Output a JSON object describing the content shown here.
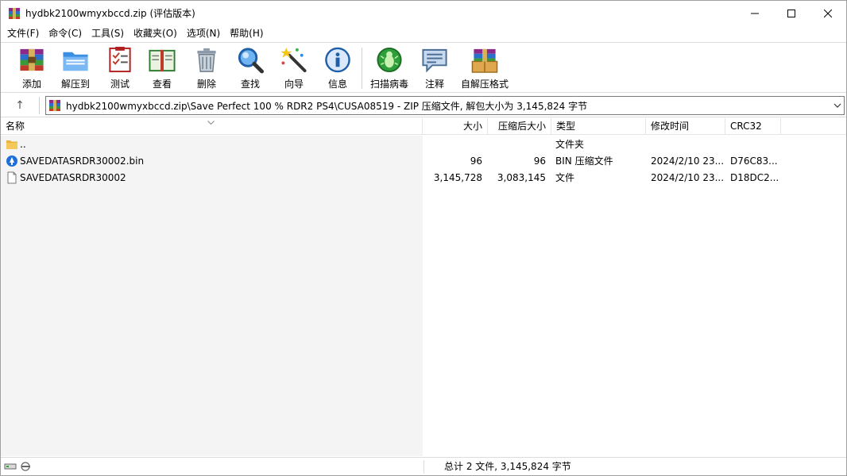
{
  "window": {
    "title": "hydbk2100wmyxbccd.zip (评估版本)",
    "minimize_glyph": "—",
    "maximize_glyph": "☐",
    "close_glyph": "✕"
  },
  "menu": [
    "文件(F)",
    "命令(C)",
    "工具(S)",
    "收藏夹(O)",
    "选项(N)",
    "帮助(H)"
  ],
  "toolbar": {
    "add": "添加",
    "extract": "解压到",
    "test": "测试",
    "view": "查看",
    "delete": "删除",
    "find": "查找",
    "wizard": "向导",
    "info": "信息",
    "virus_scan": "扫描病毒",
    "comment": "注释",
    "sfx": "自解压格式"
  },
  "address": {
    "path": "hydbk2100wmyxbccd.zip\\Save Perfect 100 % RDR2 PS4\\CUSA08519 - ZIP 压缩文件, 解包大小为 3,145,824 字节",
    "up_glyph": "↑",
    "dropdown_glyph": "⌄"
  },
  "columns": {
    "name": "名称",
    "size": "大小",
    "packed": "压缩后大小",
    "type": "类型",
    "modified": "修改时间",
    "crc": "CRC32"
  },
  "rows": [
    {
      "name": "..",
      "size": "",
      "packed": "",
      "type": "文件夹",
      "modified": "",
      "crc": "",
      "icon": "folder-icon"
    },
    {
      "name": "SAVEDATASRDR30002.bin",
      "size": "96",
      "packed": "96",
      "type": "BIN 压缩文件",
      "modified": "2024/2/10 23...",
      "crc": "D76C83...",
      "icon": "bin-file-icon"
    },
    {
      "name": "SAVEDATASRDR30002",
      "size": "3,145,728",
      "packed": "3,083,145",
      "type": "文件",
      "modified": "2024/2/10 23...",
      "crc": "D18DC2...",
      "icon": "file-icon"
    }
  ],
  "status": {
    "summary": "总计 2 文件, 3,145,824 字节"
  },
  "colors": {
    "accent": "#1e6fd9",
    "folder": "#f5c85a"
  }
}
